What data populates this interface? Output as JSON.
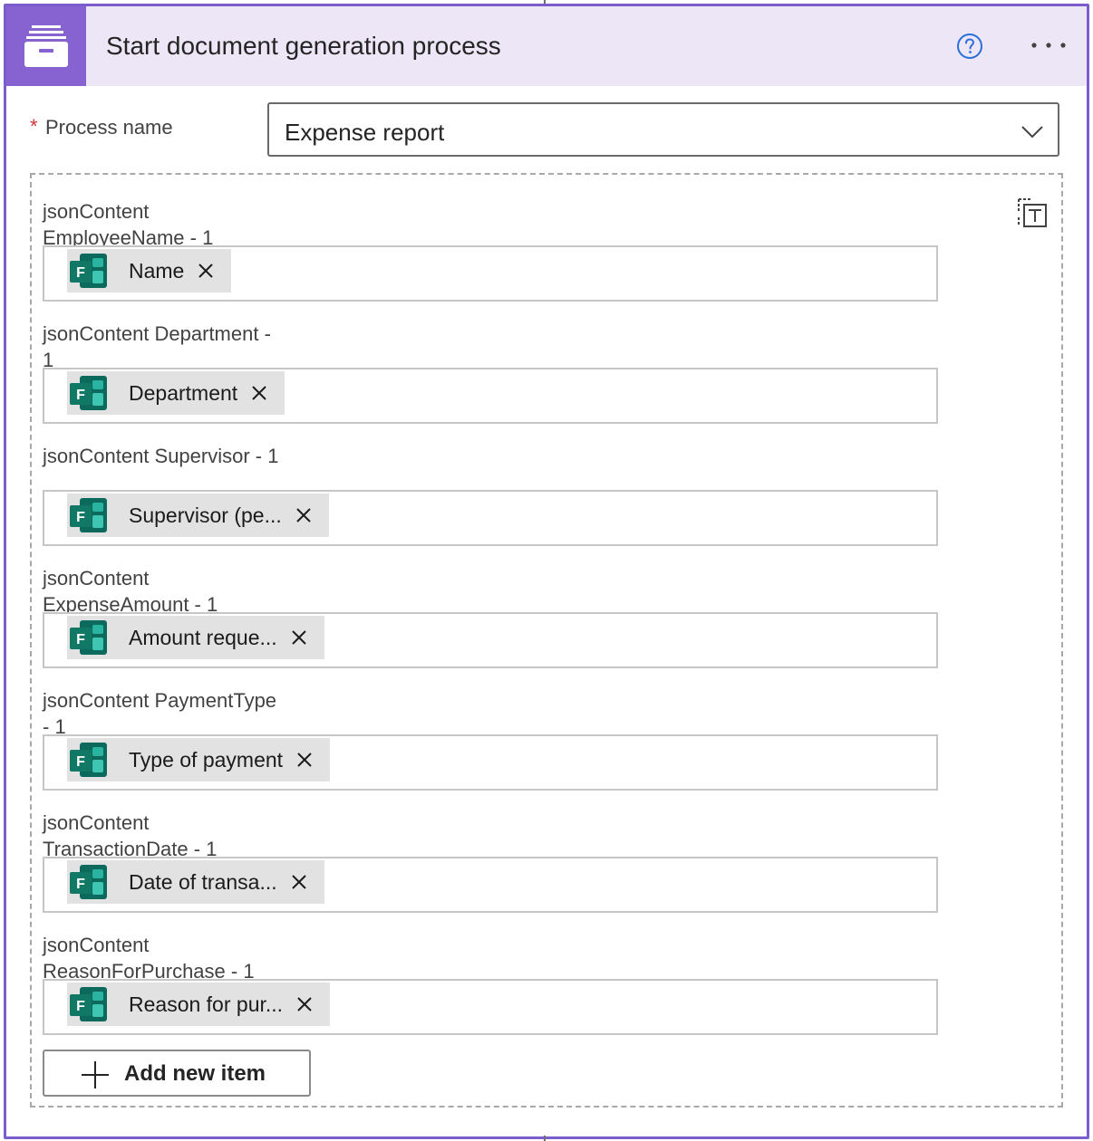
{
  "header": {
    "title": "Start document generation process",
    "app_icon": "file-cabinet-icon",
    "help_icon": "help-circle-icon",
    "more_icon": "more-horizontal-icon",
    "accent_color": "#8763d1",
    "header_bg": "#ece6f7"
  },
  "process": {
    "required_mark": "*",
    "label": "Process name",
    "value": "Expense report"
  },
  "fields": [
    {
      "label": "jsonContent EmployeeName - 1",
      "token": "Name"
    },
    {
      "label": "jsonContent Department - 1",
      "token": "Department"
    },
    {
      "label": "jsonContent Supervisor - 1",
      "token": "Supervisor (pe..."
    },
    {
      "label": "jsonContent ExpenseAmount - 1",
      "token": "Amount reque..."
    },
    {
      "label": "jsonContent PaymentType - 1",
      "token": "Type of payment"
    },
    {
      "label": "jsonContent TransactionDate - 1",
      "token": "Date of transa..."
    },
    {
      "label": "jsonContent ReasonForPurchase - 1",
      "token": "Reason for pur..."
    }
  ],
  "token_icon": "microsoft-forms-icon",
  "switch_mode_icon": "text-mode-icon",
  "add_button": {
    "label": "Add new item"
  }
}
